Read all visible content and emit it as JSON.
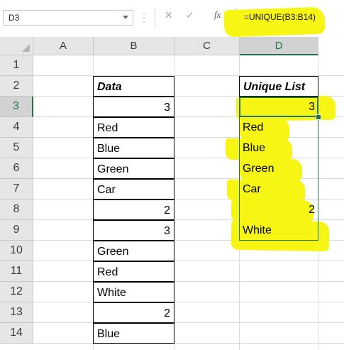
{
  "formula_bar": {
    "name_box": "D3",
    "cancel_icon": "✕",
    "enter_icon": "✓",
    "fx_label": "fx",
    "formula": "=UNIQUE(B3:B14)"
  },
  "columns": [
    "A",
    "B",
    "C",
    "D"
  ],
  "rows": [
    "1",
    "2",
    "3",
    "4",
    "5",
    "6",
    "7",
    "8",
    "9",
    "10",
    "11",
    "12",
    "13",
    "14"
  ],
  "selected_cell": "D3",
  "data_column": {
    "header": "Data",
    "values": [
      "3",
      "Red",
      "Blue",
      "Green",
      "Car",
      "2",
      "3",
      "Green",
      "Red",
      "White",
      "2",
      "Blue"
    ]
  },
  "unique_column": {
    "header": "Unique List",
    "values": [
      "3",
      "Red",
      "Blue",
      "Green",
      "Car",
      "2",
      "White"
    ]
  },
  "colors": {
    "highlight": "#f7f513",
    "selection": "#217346"
  }
}
